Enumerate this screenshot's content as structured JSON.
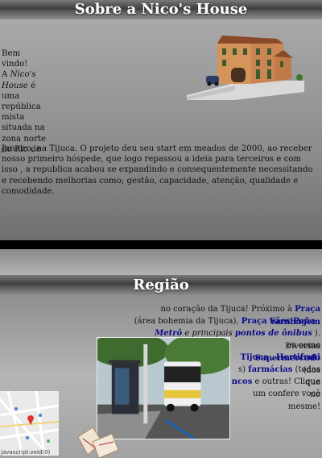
{
  "section1": {
    "title": "Sobre a Nico's House",
    "welcome": "Bem vindo!",
    "intro_pre": "A ",
    "intro_name": "Nico's House",
    "intro_post": " é uma república mista situada na zona norte do Rio de",
    "body": "Janeiro, na Tijuca. O projeto deu seu start em meados de 2000, ao receber nosso primeiro hóspede, que logo repassou a ideia para terceiros e com isso , a republica acabou se expandindo e consequentemente necessitando e recebendo melhorias como; gestão, capacidade, atenção, qualidade e comodidade.",
    "image": "house-photo"
  },
  "section2": {
    "title": "Região",
    "l1_text": "no coração da Tijuca! Próximo à ",
    "l1_link": "Praça Varnhagem",
    "l2_text": "(área bohemia da Tijuca), ",
    "l2_link": "Praça Sães Peña",
    "l2_end": " ,",
    "l3_link1": "Metrô",
    "l3_mid": " e principais ",
    "l3_link2": "pontos de ônibus",
    "l3_text": " ). Diversas",
    "l4_text": "es como ",
    "l4_link": "Supermercado",
    "l5_link1": "Tijuca",
    "l5_mid": " , ",
    "l5_link2": "Hortifruti",
    "l5_end": " (dos",
    "l6_text": "s) ",
    "l6_link": "farmácias",
    "l6_end": " (todas que",
    "l7_link": "ncos",
    "l7_text": " e outras! Clique no",
    "l8_text": "um confere você mesme!",
    "map_caption": "javascript:void(0)"
  },
  "colors": {
    "link": "#0b0b8a",
    "bar": "#000000"
  }
}
